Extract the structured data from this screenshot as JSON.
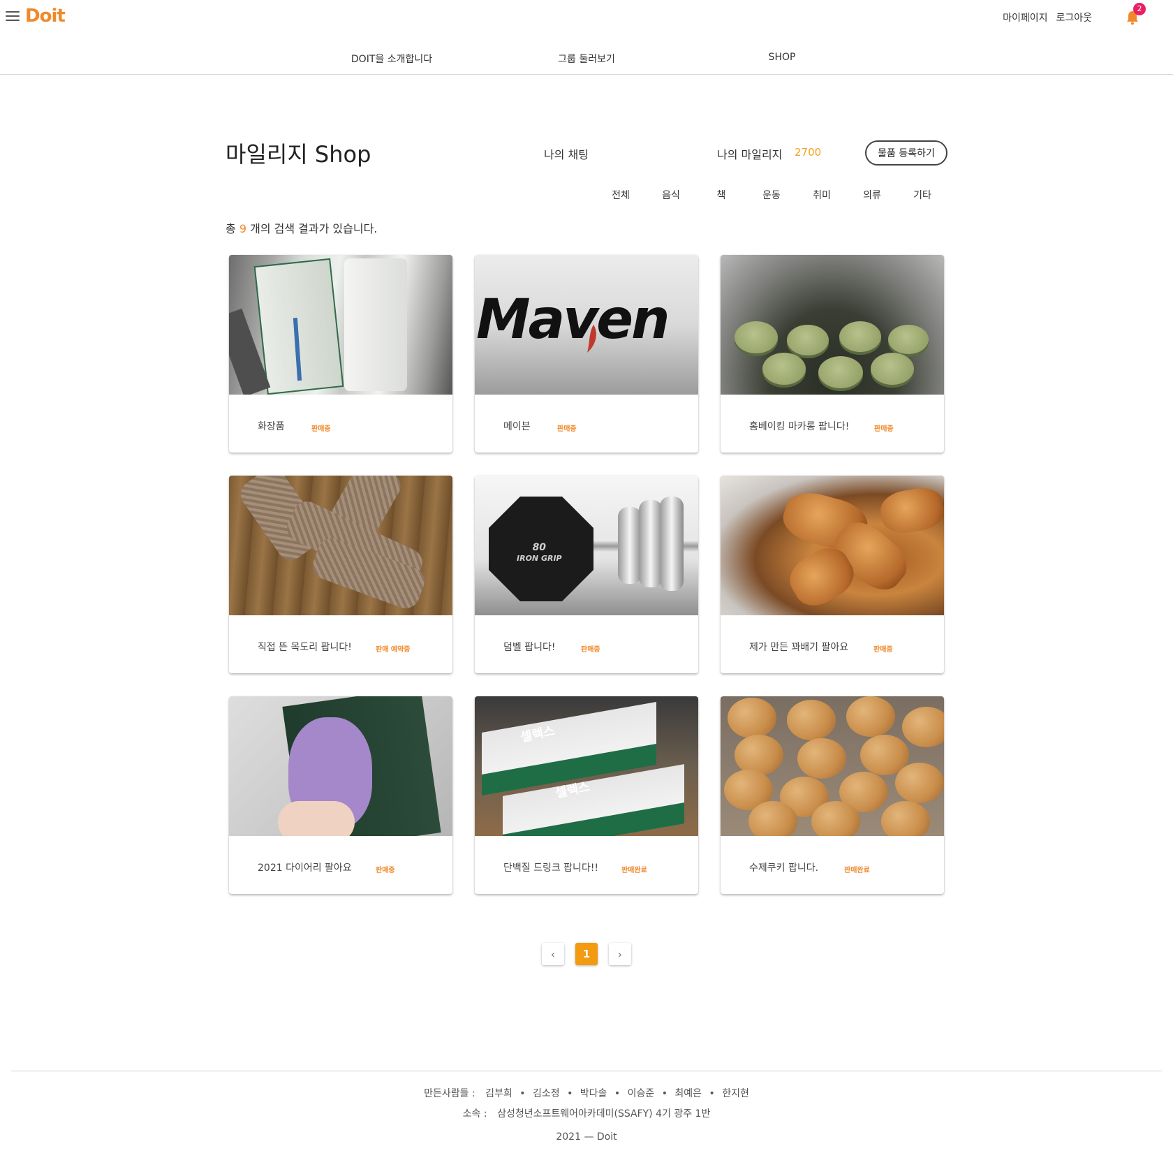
{
  "header": {
    "logo": "Doit",
    "mypage": "마이페이지",
    "logout": "로그아웃",
    "notification_count": "2"
  },
  "nav": [
    {
      "label": "DOIT을 소개합니다"
    },
    {
      "label": "그룹 둘러보기"
    },
    {
      "label": "SHOP"
    }
  ],
  "shop": {
    "title": "마일리지 Shop",
    "my_chat": "나의 채팅",
    "mileage_label": "나의 마일리지",
    "mileage_value": "2700",
    "register_button": "물품 등록하기"
  },
  "categories": [
    "전체",
    "음식",
    "책",
    "운동",
    "취미",
    "의류",
    "기타"
  ],
  "results": {
    "prefix": "총",
    "count": "9",
    "suffix": "개의 검색 결과가 있습니다."
  },
  "items": [
    {
      "title": "화장품",
      "status": "판매중",
      "image": "cosmetics-photo"
    },
    {
      "title": "메이븐",
      "status": "판매중",
      "image": "maven-logo"
    },
    {
      "title": "홈베이킹 마카롱 팝니다!",
      "status": "판매중",
      "image": "macaron-photo"
    },
    {
      "title": "직접 뜬 목도리 팝니다!",
      "status": "판매 예약중",
      "image": "scarf-photo"
    },
    {
      "title": "덤벨 팝니다!",
      "status": "판매중",
      "image": "dumbbell-photo"
    },
    {
      "title": "제가 만든 꽈배기 팔아요",
      "status": "판매중",
      "image": "pastry-photo"
    },
    {
      "title": "2021 다이어리 팔아요",
      "status": "판매중",
      "image": "diary-photo"
    },
    {
      "title": "단백질 드링크 팝니다!!",
      "status": "판매완료",
      "image": "protein-drink-photo"
    },
    {
      "title": "수제쿠키 팝니다.",
      "status": "판매완료",
      "image": "cookies-photo"
    }
  ],
  "image_text": {
    "maven": "Maven",
    "dumbbell_line1": "80",
    "dumbbell_line2": "IRON GRIP",
    "protein_brand": "셀렉스"
  },
  "pagination": {
    "prev": "‹",
    "current": "1",
    "next": "›"
  },
  "footer": {
    "makers_label": "만든사람들 :",
    "makers": [
      "김부희",
      "김소정",
      "박다솔",
      "이승준",
      "최예은",
      "한지현"
    ],
    "separator": "•",
    "org_label": "소속 :",
    "org": "삼성청년소프트웨어아카데미(SSAFY) 4기 광주 1반",
    "copyright": "2021 — Doit"
  },
  "colors": {
    "brand": "#f0892a",
    "mileage": "#f0a21a",
    "badge": "#e91e63",
    "page_active": "#f29b11"
  }
}
